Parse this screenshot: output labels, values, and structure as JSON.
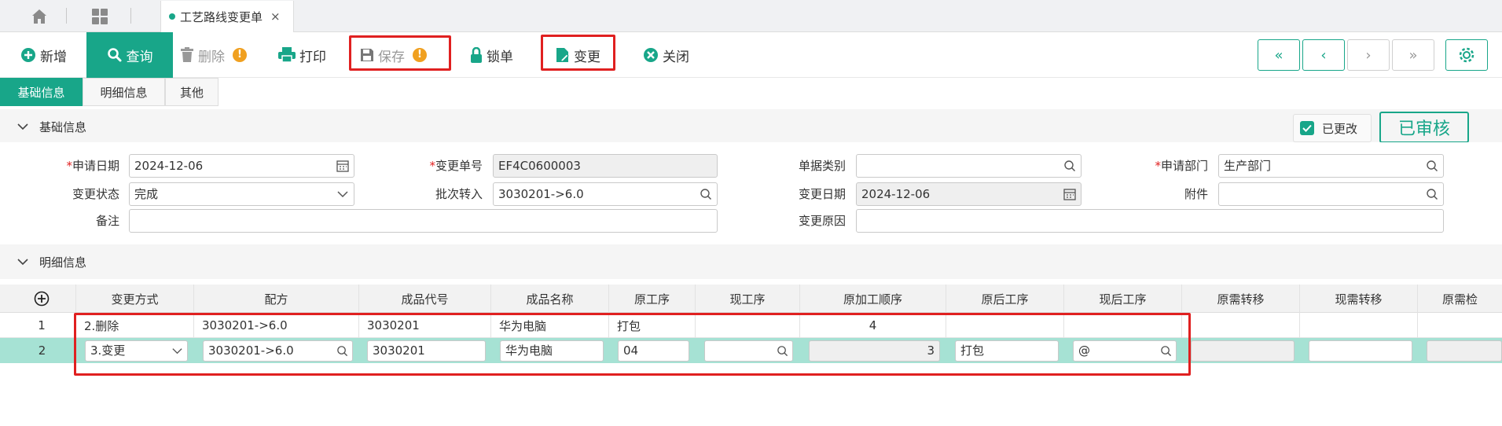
{
  "tabs": {
    "doc_tab": "工艺路线变更单",
    "close": "×"
  },
  "toolbar": {
    "new": "新增",
    "query": "查询",
    "delete": "删除",
    "print": "打印",
    "save": "保存",
    "lock": "锁单",
    "change": "变更",
    "close": "关闭",
    "warn": "!"
  },
  "nav": {
    "first": "«",
    "prev": "‹",
    "next": "›",
    "last": "»"
  },
  "subtabs": [
    "基础信息",
    "明细信息",
    "其他"
  ],
  "basic": {
    "section_title": "基础信息",
    "changed_label": "已更改",
    "approved": "已审核",
    "required_mark": "*",
    "apply_date_label": "申请日期",
    "apply_date": "2024-12-06",
    "change_no_label": "变更单号",
    "change_no": "EF4C0600003",
    "doc_type_label": "单据类别",
    "doc_type": "",
    "apply_dept_label": "申请部门",
    "apply_dept": "生产部门",
    "change_status_label": "变更状态",
    "change_status": "完成",
    "batch_label": "批次转入",
    "batch": "3030201->6.0",
    "change_date_label": "变更日期",
    "change_date": "2024-12-06",
    "attachment_label": "附件",
    "attachment": "",
    "remark_label": "备注",
    "remark": "",
    "reason_label": "变更原因",
    "reason": ""
  },
  "detail": {
    "section_title": "明细信息",
    "add_icon": "⊕",
    "columns": [
      "变更方式",
      "配方",
      "成品代号",
      "成品名称",
      "原工序",
      "现工序",
      "原加工顺序",
      "原后工序",
      "现后工序",
      "原需转移",
      "现需转移",
      "原需检"
    ],
    "rows": [
      {
        "no": "1",
        "method": "2.删除",
        "formula": "3030201->6.0",
        "product_code": "3030201",
        "product_name": "华为电脑",
        "orig_proc": "打包",
        "curr_proc": "",
        "orig_seq": "4",
        "orig_next": "",
        "curr_next": ""
      },
      {
        "no": "2",
        "method": "3.变更",
        "formula": "3030201->6.0",
        "product_code": "3030201",
        "product_name": "华为电脑",
        "orig_proc": "04",
        "curr_proc": "",
        "orig_seq": "3",
        "orig_next": "打包",
        "curr_next": "@"
      }
    ]
  },
  "colors": {
    "accent": "#18a689",
    "highlight_row": "#a6e2d4",
    "red_box": "#e02020",
    "warn": "#f0a020"
  }
}
